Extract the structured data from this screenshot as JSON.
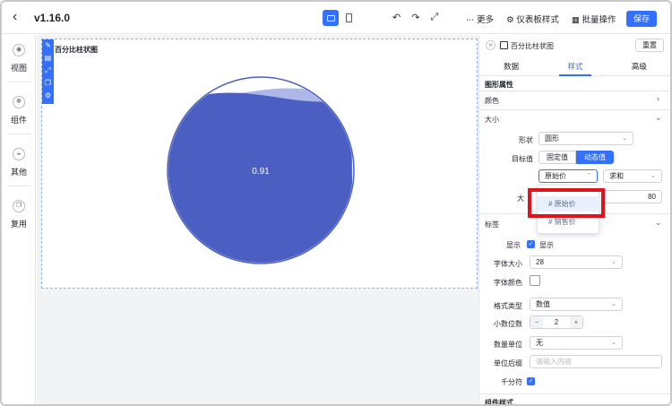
{
  "header": {
    "version": "v1.16.0",
    "more_label": "更多",
    "dashboard_style_label": "仪表板样式",
    "batch_label": "批量操作",
    "save_label": "保存"
  },
  "rail": {
    "items": [
      {
        "label": "视图"
      },
      {
        "label": "组件"
      },
      {
        "label": "其他"
      },
      {
        "label": "复用"
      }
    ]
  },
  "chart": {
    "title": "百分比柱状图",
    "value_label": "0.91"
  },
  "chart_data": {
    "type": "liquid-fill",
    "value": 0.91,
    "label": "0.91",
    "fill_color": "#4a5fc1"
  },
  "panel": {
    "chart_name": "百分比柱状图",
    "reset_label": "重置",
    "tabs": [
      "数据",
      "样式",
      "高级"
    ],
    "graphic_props_label": "图形属性",
    "color_label": "颜色",
    "size_label": "大小",
    "shape_label": "形状",
    "shape_value": "圆形",
    "target_label": "目标值",
    "target_fixed": "固定值",
    "target_dynamic": "动态值",
    "field_value": "原始价",
    "agg_value": "求和",
    "size_row_label": "大",
    "size_value": "80",
    "tag_label": "标签",
    "show_label": "显示",
    "show_text": "显示",
    "font_size_label": "字体大小",
    "font_size_value": "28",
    "font_color_label": "字体颜色",
    "format_type_label": "格式类型",
    "format_type_value": "数值",
    "decimal_label": "小数位数",
    "decimal_value": "2",
    "unit_label": "数量单位",
    "unit_value": "无",
    "suffix_label": "单位后缀",
    "suffix_placeholder": "请输入内容",
    "thousands_label": "千分符",
    "component_style_label": "组件样式"
  },
  "dropdown": {
    "options": [
      "# 原始价",
      "# 销售价"
    ]
  },
  "colors": {
    "accent": "#3370ff",
    "highlight": "#e0131a",
    "fill": "#4a5fc1"
  }
}
